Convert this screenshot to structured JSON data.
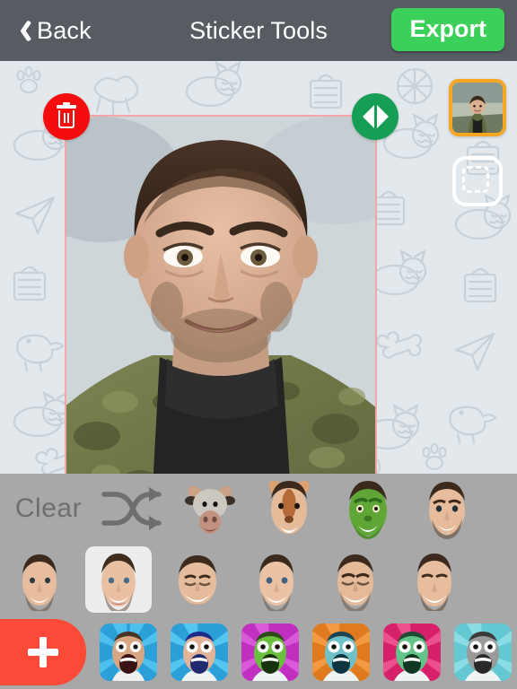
{
  "header": {
    "back_label": "Back",
    "back_icon": "chevron-left-icon",
    "title": "Sticker Tools",
    "export_label": "Export",
    "export_color": "#3ad05a",
    "bar_color": "#565c62"
  },
  "canvas": {
    "background_color": "#e3e8ec",
    "doodle_motifs": [
      "dog",
      "cat",
      "paw-print",
      "paper-plane",
      "bone",
      "bird",
      "ball",
      "bag"
    ],
    "selection": {
      "frame_color": "#f4a6a6",
      "delete_button": {
        "icon": "trash-icon",
        "color": "#f50c0c"
      },
      "flip_button": {
        "icon": "flip-horizontal-icon",
        "color": "#169e54"
      }
    },
    "sticker_subject": "man-face-cutout-with-white-outline",
    "photo_description": "man in olive camouflage jacket and black turtleneck"
  },
  "tools": {
    "photo_thumbnail": {
      "name": "source-photo-thumbnail",
      "border_color": "#f5a623"
    },
    "crop_tool": {
      "name": "crop-select-tool",
      "icon": "dashed-square-icon"
    }
  },
  "panel": {
    "background_color": "#a8a8a8",
    "clear_label": "Clear",
    "shuffle_icon": "shuffle-icon",
    "row1": [
      {
        "name": "sticker-cow",
        "label": "cow face"
      },
      {
        "name": "sticker-deer",
        "label": "deer-ears face"
      },
      {
        "name": "sticker-green",
        "label": "green monster face"
      },
      {
        "name": "sticker-plain",
        "label": "plain bearded face"
      }
    ],
    "row2": [
      {
        "name": "sticker-face-1",
        "label": "smiling face",
        "selected": false
      },
      {
        "name": "sticker-face-2",
        "label": "laughing face",
        "selected": true
      },
      {
        "name": "sticker-face-3",
        "label": "wide grin face",
        "selected": false
      },
      {
        "name": "sticker-face-4",
        "label": "happy face",
        "selected": false
      },
      {
        "name": "sticker-face-5",
        "label": "open mouth face",
        "selected": false
      },
      {
        "name": "sticker-face-6",
        "label": "toothy face",
        "selected": false
      }
    ],
    "add_button": {
      "name": "add-sticker-button",
      "icon": "plus-icon",
      "color": "#fc4a38"
    },
    "row3": [
      {
        "name": "app-sticker-1",
        "bg": "#2a9fd8",
        "face": "#d7a88a"
      },
      {
        "name": "app-sticker-2",
        "bg": "#2a9fd8",
        "face": "#e2b396"
      },
      {
        "name": "app-sticker-3",
        "bg": "#c02fc0",
        "face": "#6bbf3e"
      },
      {
        "name": "app-sticker-4",
        "bg": "#e07a1f",
        "face": "#6fc0c8"
      },
      {
        "name": "app-sticker-5",
        "bg": "#d6206a",
        "face": "#63c48a"
      },
      {
        "name": "app-sticker-6",
        "bg": "#63c8d2",
        "face": "#9a9a9a"
      }
    ]
  }
}
